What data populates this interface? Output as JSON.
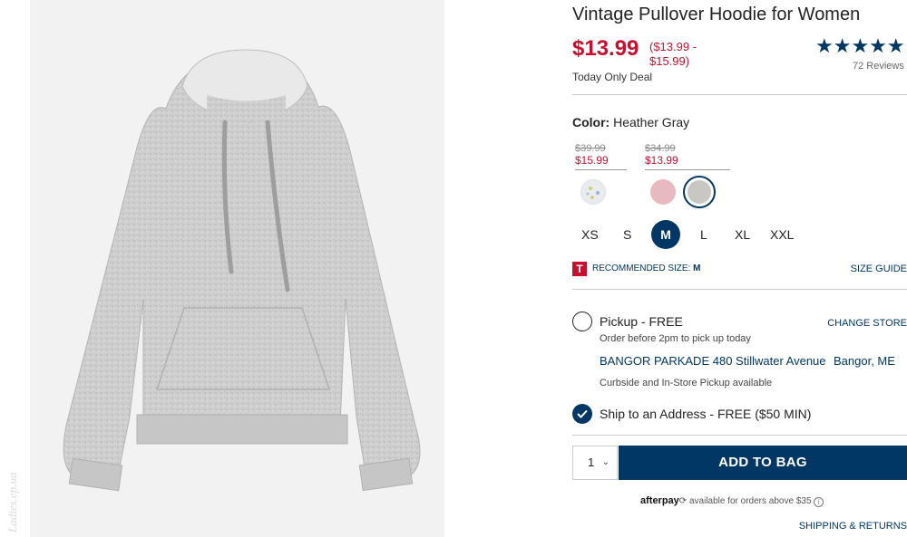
{
  "product": {
    "title": "Vintage Pullover Hoodie for Women",
    "price": "$13.99",
    "price_range": "($13.99 - $15.99)",
    "deal": "Today Only Deal",
    "stars": "★★★★★",
    "reviews": "72 Reviews"
  },
  "color": {
    "label": "Color:",
    "value": "Heather Gray",
    "groups": [
      {
        "old_price": "$39.99",
        "sale_price": "$15.99"
      },
      {
        "old_price": "$34.99",
        "sale_price": "$13.99"
      }
    ],
    "swatches": [
      {
        "name": "floral",
        "color": "#e8ecef"
      },
      {
        "name": "pink",
        "color": "#e8b9bf"
      },
      {
        "name": "heather-gray",
        "color": "#c9c7c3",
        "selected": true
      }
    ]
  },
  "sizes": {
    "options": [
      "XS",
      "S",
      "M",
      "L",
      "XL",
      "XXL"
    ],
    "selected": "M",
    "recommended_label": "RECOMMENDED SIZE:",
    "recommended_value": "M",
    "guide": "SIZE GUIDE",
    "icon_letter": "T"
  },
  "fulfillment": {
    "pickup": "Pickup - FREE",
    "change_store": "CHANGE STORE",
    "order_before": "Order before 2pm to pick up today",
    "store_name": "BANGOR PARKADE 480 Stillwater Avenue",
    "store_city": "Bangor, ME",
    "curbside": "Curbside and In-Store Pickup available",
    "ship": "Ship to an Address - FREE ($50 MIN)"
  },
  "cart": {
    "quantity": "1",
    "add_label": "ADD TO BAG"
  },
  "afterpay": {
    "logo": "afterpay",
    "text": "available for orders above $35",
    "info": "i"
  },
  "shipping_returns": "SHIPPING & RETURNS",
  "watermark": "Ladies.ep.ua",
  "colors": {
    "brand_navy": "#003764",
    "sale_red": "#c8102e"
  }
}
